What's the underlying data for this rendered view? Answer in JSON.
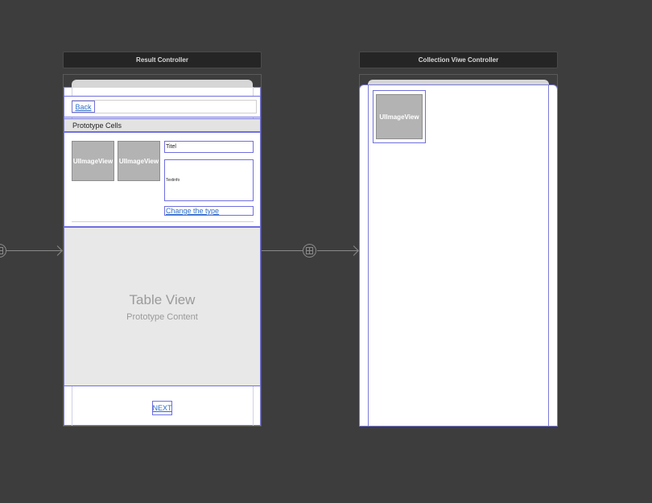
{
  "scenes": {
    "result": {
      "title": "Result Controller",
      "back_label": "Back",
      "section_header": "Prototype Cells",
      "image_views": [
        "UIImageView",
        "UIImageView"
      ],
      "title_label": "Titel",
      "text_label": "Textinfo",
      "change_label": "Change the type",
      "table_title": "Table View",
      "table_subtitle": "Prototype Content",
      "next_label": "NEXT"
    },
    "collection": {
      "title": "Collection Viwe Controller",
      "image_view": "UIImageView"
    }
  },
  "colors": {
    "canvas": "#3d3d3d",
    "selection": "#6f6fe0",
    "link": "#2c6ecb"
  }
}
